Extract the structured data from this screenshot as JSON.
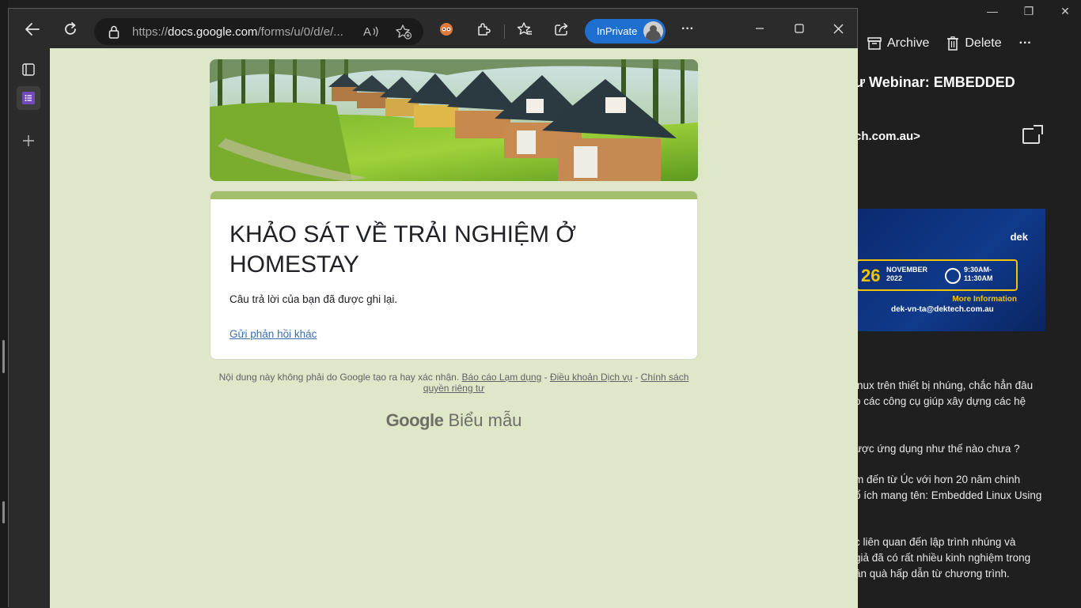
{
  "browser": {
    "url_prefix": "https://",
    "url_host": "docs.google.com",
    "url_path": "/forms/u/0/d/e/...",
    "inprivate_label": "InPrivate",
    "more_label": "···"
  },
  "form": {
    "title": "KHẢO SÁT VỀ TRẢI NGHIỆM Ở HOMESTAY",
    "confirmation": "Câu trả lời của bạn đã được ghi lại.",
    "resubmit_link": "Gửi phản hồi khác",
    "accent_color": "#a3be6d",
    "background_color": "#dfe7c9"
  },
  "footer": {
    "disclaimer": "Nội dung này không phải do Google tạo ra hay xác nhận.",
    "report_link": "Báo cáo Lạm dụng",
    "sep1": " - ",
    "terms_link": "Điều khoản Dịch vụ",
    "sep2": " - ",
    "privacy_link": "Chính sách quyền riêng tư",
    "brand_google": "Google",
    "brand_forms": "Biểu mẫu"
  },
  "mail": {
    "toolbar": {
      "archive_label": "Archive",
      "delete_label": "Delete",
      "more_label": "···"
    },
    "subject": "ư Webinar: EMBEDDED",
    "sender": "ch.com.au>",
    "banner": {
      "logo": "dek",
      "day": "26",
      "month_line1": "NOVEMBER",
      "month_line2": "2022",
      "time_line1": "9:30AM-",
      "time_line2": "11:30AM",
      "more_info": "More Information",
      "email": "dek-vn-ta@dektech.com.au"
    },
    "paragraphs": [
      "inux trên thiết bị nhúng, chắc hẳn đâu",
      "o các công cụ giúp xây dựng các hệ",
      "ược ứng dụng như thế nào chưa ?",
      "m đến từ Úc với hơn 20 năm chinh",
      "ổ ích mang tên: Embedded Linux Using",
      "c liên quan đến lập trình nhúng và",
      "giả đã có rất nhiều kinh nghiệm trong",
      "ần quà hấp dẫn từ chương trình."
    ]
  }
}
